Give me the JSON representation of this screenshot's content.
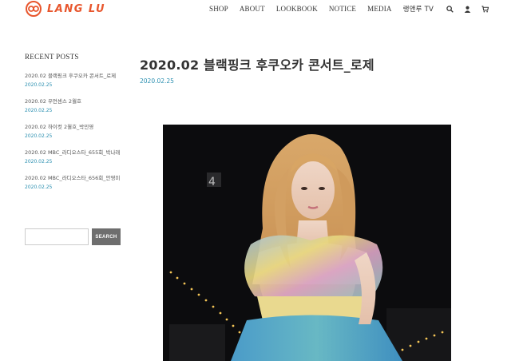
{
  "header": {
    "logo_text": "LANG LU",
    "logo_icon": "sun-double-circle-logo",
    "accent_color": "#e8562d",
    "nav": [
      {
        "label": "SHOP"
      },
      {
        "label": "ABOUT"
      },
      {
        "label": "LOOKBOOK"
      },
      {
        "label": "NOTICE"
      },
      {
        "label": "MEDIA"
      },
      {
        "label": "랭앤루 TV"
      }
    ],
    "icons": [
      "search-icon",
      "user-icon",
      "cart-icon"
    ]
  },
  "sidebar": {
    "title": "RECENT POSTS",
    "posts": [
      {
        "title": "2020.02 블랙핑크 후쿠오카 콘서트_로제",
        "date": "2020.02.25"
      },
      {
        "title": "2020.02 우먼센스 2월호",
        "date": "2020.02.25"
      },
      {
        "title": "2020.02 하이컷 2월호_박민영",
        "date": "2020.02.25"
      },
      {
        "title": "2020.02 MBC_라디오스타_655회_박나래",
        "date": "2020.02.25"
      },
      {
        "title": "2020.02 MBC_라디오스타_656회_안영미",
        "date": "2020.02.25"
      }
    ],
    "search": {
      "placeholder": "",
      "button_label": "SEARCH"
    }
  },
  "main": {
    "title": "2020.02 블랙핑크 후쿠오카 콘서트_로제",
    "date": "2020.02.25",
    "link_color": "#2a8fb0"
  }
}
